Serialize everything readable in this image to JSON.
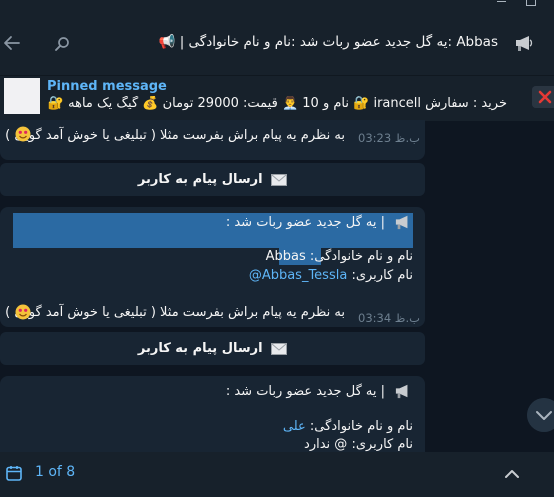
{
  "header": {
    "title": "Abbas :یه گل جدید عضو ربات شد :نام و نام خانوادگی | 📢"
  },
  "pinned": {
    "title": "Pinned message",
    "text": "خرید : سفارش irancell 🔐 نام و 10 👨‍💼 قیمت: 29000 تومان 💰 گیگ یک ماهه 🔐 ..."
  },
  "messages": [
    {
      "text": "به نظرم یه پیام براش بفرست مثلا ( تبلیغی یا خوش آمد گویی )",
      "time": "ب.ظ 03:23",
      "button": "ارسال پیام به کاربر"
    },
    {
      "line1": "| یه گل جدید عضو ربات شد :",
      "name_label": "نام و نام خانوادگی:",
      "name_value": "Abbas",
      "user_label": "نام کاربری:",
      "user_value": "@Abbas_Tessla",
      "text": "به نظرم یه پیام براش بفرست مثلا ( تبلیغی یا خوش آمد گویی )",
      "time": "ب.ظ 03:34",
      "button": "ارسال پیام به کاربر"
    },
    {
      "line1": "| یه گل جدید عضو ربات شد :",
      "name_label": "نام و نام خانوادگی:",
      "name_value": "علی",
      "user_label": "نام کاربری:",
      "user_value": "@ ندارد"
    }
  ],
  "footer": {
    "counter": "1 of 8"
  },
  "colors": {
    "background": "#0e1621",
    "panel": "#17212b",
    "bubble": "#182533",
    "accent": "#5eb5f7",
    "selection": "#2b6aa3"
  },
  "icons": [
    "back-arrow-icon",
    "search-icon",
    "megaphone-icon",
    "close-icon",
    "envelope-icon",
    "smiling-face-icon",
    "calendar-icon",
    "chevron-up-icon",
    "chevron-down-icon"
  ]
}
